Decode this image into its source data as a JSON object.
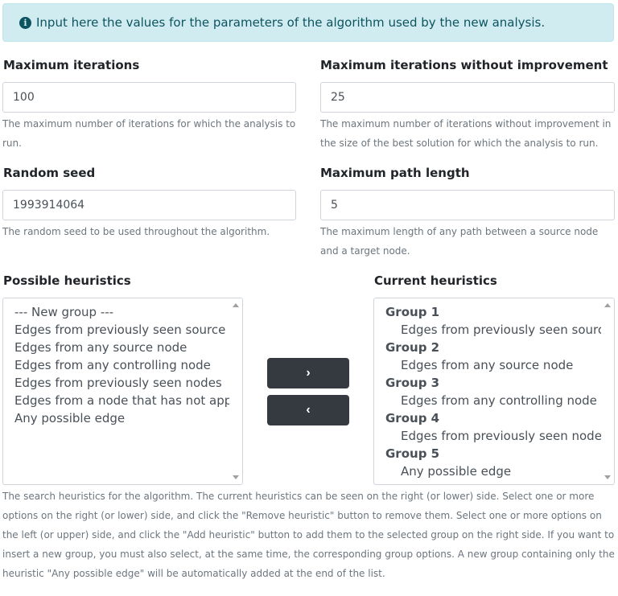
{
  "alert": {
    "icon": "info-circle-icon",
    "text": "Input here the values for the parameters of the algorithm used by the new analysis."
  },
  "max_iterations": {
    "label": "Maximum iterations",
    "value": "100",
    "help": "The maximum number of iterations for which the analysis to run."
  },
  "max_iterations_without_improvement": {
    "label": "Maximum iterations without improvement",
    "value": "25",
    "help": "The maximum number of iterations without improvement in the size of the best solution for which the analysis to run."
  },
  "random_seed": {
    "label": "Random seed",
    "value": "1993914064",
    "help": "The random seed to be used throughout the algorithm."
  },
  "max_path_length": {
    "label": "Maximum path length",
    "value": "5",
    "help": "The maximum length of any path between a source node and a target node."
  },
  "possible_heuristics": {
    "label": "Possible heuristics",
    "options": [
      "--- New group ---",
      "Edges from previously seen source no",
      "Edges from any source node",
      "Edges from any controlling node",
      "Edges from previously seen nodes",
      "Edges from a node that has not appea",
      "Any possible edge"
    ]
  },
  "current_heuristics": {
    "label": "Current heuristics",
    "groups": [
      {
        "name": "Group 1",
        "item": "Edges from previously seen source"
      },
      {
        "name": "Group 2",
        "item": "Edges from any source node"
      },
      {
        "name": "Group 3",
        "item": "Edges from any controlling node"
      },
      {
        "name": "Group 4",
        "item": "Edges from previously seen nodes"
      },
      {
        "name": "Group 5",
        "item": "Any possible edge"
      }
    ]
  },
  "buttons": {
    "add": "›",
    "remove": "‹"
  },
  "heuristics_help": "The search heuristics for the algorithm. The current heuristics can be seen on the right (or lower) side. Select one or more options on the right (or lower) side, and click the \"Remove heuristic\" button to remove them. Select one or more options on the left (or upper) side, and click the \"Add heuristic\" button to add them to the selected group on the right side. If you want to insert a new group, you must also select, at the same time, the corresponding group options. A new group containing only the heuristic \"Any possible edge\" will be automatically added at the end of the list."
}
